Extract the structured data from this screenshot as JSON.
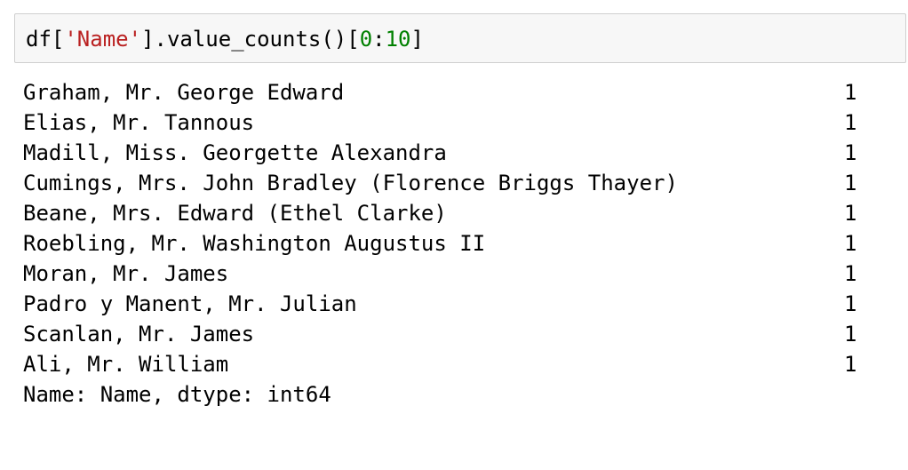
{
  "input": {
    "prefix": "df[",
    "string_arg": "'Name'",
    "middle": "].value_counts()[",
    "slice_start": "0",
    "colon": ":",
    "slice_end": "10",
    "suffix": "]"
  },
  "output": {
    "rows": [
      {
        "name": "Graham, Mr. George Edward",
        "count": "1"
      },
      {
        "name": "Elias, Mr. Tannous",
        "count": "1"
      },
      {
        "name": "Madill, Miss. Georgette Alexandra",
        "count": "1"
      },
      {
        "name": "Cumings, Mrs. John Bradley (Florence Briggs Thayer)",
        "count": "1"
      },
      {
        "name": "Beane, Mrs. Edward (Ethel Clarke)",
        "count": "1"
      },
      {
        "name": "Roebling, Mr. Washington Augustus II",
        "count": "1"
      },
      {
        "name": "Moran, Mr. James",
        "count": "1"
      },
      {
        "name": "Padro y Manent, Mr. Julian",
        "count": "1"
      },
      {
        "name": "Scanlan, Mr. James",
        "count": "1"
      },
      {
        "name": "Ali, Mr. William",
        "count": "1"
      }
    ],
    "footer": "Name: Name, dtype: int64"
  },
  "colors": {
    "string": "#ba2121",
    "number": "#008000",
    "cell_background": "#f7f7f7",
    "cell_border": "#cfcfcf"
  }
}
